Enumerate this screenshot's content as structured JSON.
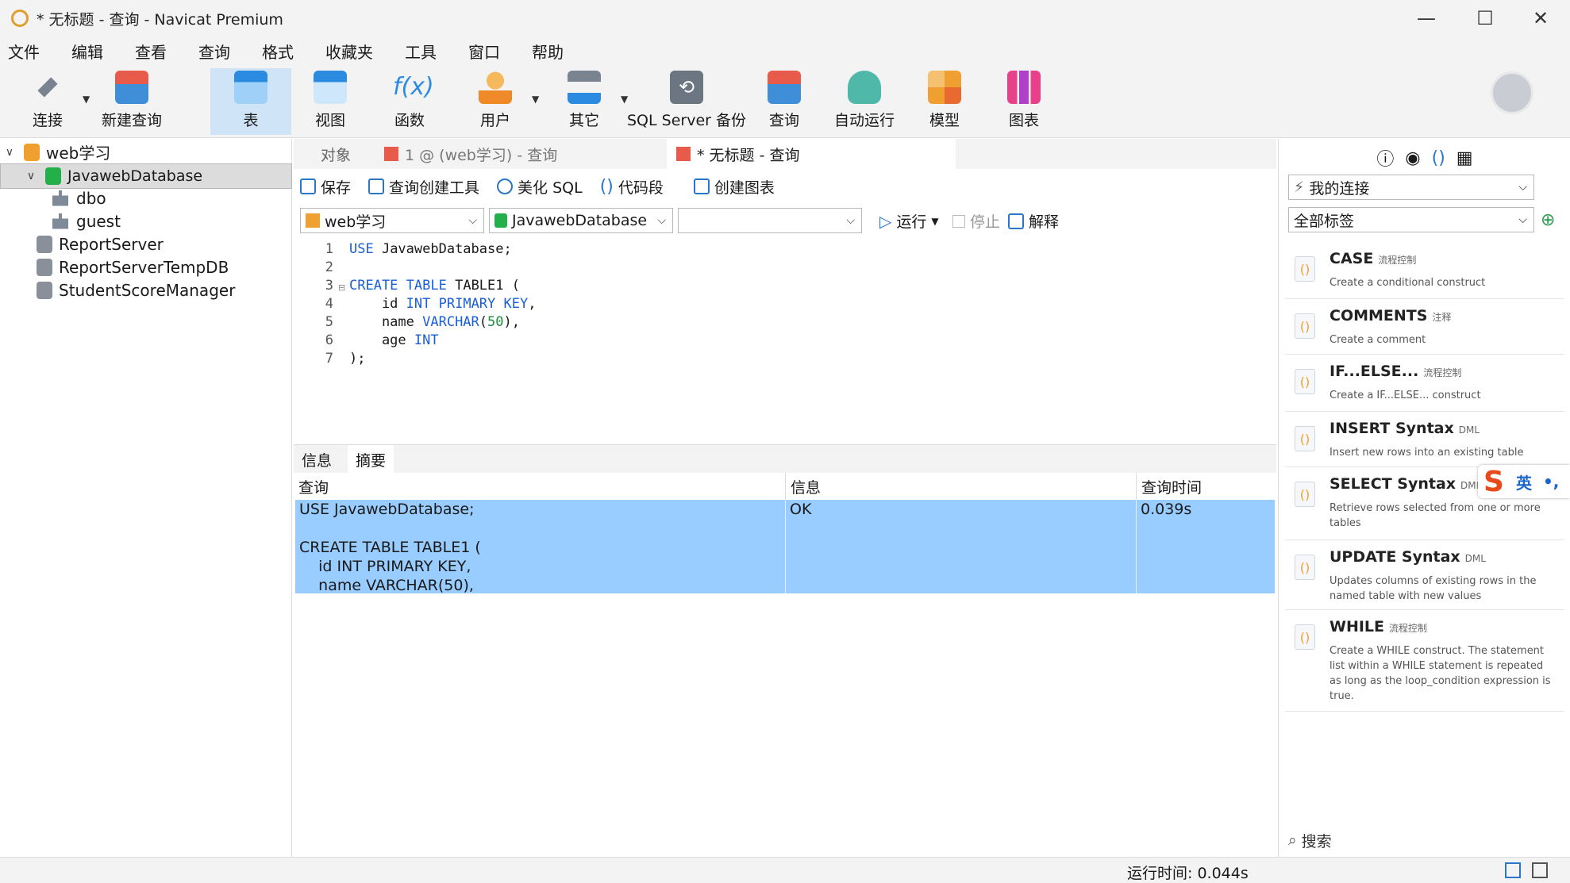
{
  "window": {
    "title": "* 无标题 - 查询 - Navicat Premium"
  },
  "menu": [
    "文件",
    "编辑",
    "查看",
    "查询",
    "格式",
    "收藏夹",
    "工具",
    "窗口",
    "帮助"
  ],
  "toolbar": {
    "items": [
      {
        "label": "连接",
        "icon": "plug-icon"
      },
      {
        "label": "新建查询",
        "icon": "new-query-icon"
      },
      {
        "label": "表",
        "icon": "table-icon"
      },
      {
        "label": "视图",
        "icon": "view-icon"
      },
      {
        "label": "函数",
        "icon": "function-icon"
      },
      {
        "label": "用户",
        "icon": "user-icon"
      },
      {
        "label": "其它",
        "icon": "tools-icon"
      },
      {
        "label": "SQL Server 备份",
        "icon": "backup-icon"
      },
      {
        "label": "查询",
        "icon": "query-icon"
      },
      {
        "label": "自动运行",
        "icon": "robot-icon"
      },
      {
        "label": "模型",
        "icon": "model-icon"
      },
      {
        "label": "图表",
        "icon": "chart-icon"
      }
    ],
    "active": "表"
  },
  "tree": {
    "connection": "web学习",
    "database": "JavawebDatabase",
    "schemas": [
      "dbo",
      "guest"
    ],
    "other_dbs": [
      "ReportServer",
      "ReportServerTempDB",
      "StudentScoreManager"
    ]
  },
  "tabs": {
    "objects": "对象",
    "tab1": "1 @ (web学习) - 查询",
    "tab2": "* 无标题 - 查询"
  },
  "query_toolbar": {
    "save": "保存",
    "builder": "查询创建工具",
    "beautify": "美化 SQL",
    "snippet": "代码段",
    "chart": "创建图表"
  },
  "selectors": {
    "connection": "web学习",
    "database": "JavawebDatabase",
    "schema": "",
    "run": "运行",
    "stop": "停止",
    "explain": "解释"
  },
  "editor": {
    "line_numbers": [
      "1",
      "2",
      "3",
      "4",
      "5",
      "6",
      "7"
    ]
  },
  "results": {
    "tabs": [
      "信息",
      "摘要"
    ],
    "active_tab": "摘要",
    "columns": [
      "查询",
      "信息",
      "查询时间"
    ],
    "row": {
      "query": "USE JavawebDatabase;\n\nCREATE TABLE TABLE1 (\n    id INT PRIMARY KEY,\n    name VARCHAR(50),",
      "info": "OK",
      "time": "0.039s"
    }
  },
  "right_panel": {
    "connection_select": "我的连接",
    "tag_select": "全部标签",
    "snippets": [
      {
        "name": "CASE",
        "tag": "流程控制",
        "desc": "Create a conditional construct"
      },
      {
        "name": "COMMENTS",
        "tag": "注释",
        "desc": "Create a comment"
      },
      {
        "name": "IF...ELSE...",
        "tag": "流程控制",
        "desc": "Create a IF...ELSE... construct"
      },
      {
        "name": "INSERT Syntax",
        "tag": "DML",
        "desc": "Insert new rows into an existing table"
      },
      {
        "name": "SELECT Syntax",
        "tag": "DML",
        "desc": "Retrieve rows selected from one or more tables"
      },
      {
        "name": "UPDATE Syntax",
        "tag": "DML",
        "desc": "Updates columns of existing rows in the named table with new values"
      },
      {
        "name": "WHILE",
        "tag": "流程控制",
        "desc": "Create a WHILE construct. The statement list within a WHILE statement is repeated as long as the loop_condition expression is true."
      }
    ],
    "search_placeholder": "搜索"
  },
  "ime": {
    "label": "英"
  },
  "status": {
    "run_time": "运行时间: 0.044s"
  },
  "colors": {
    "accent": "#2a77c9",
    "selection": "#99ccff",
    "active_tool": "#cfe4f7"
  }
}
